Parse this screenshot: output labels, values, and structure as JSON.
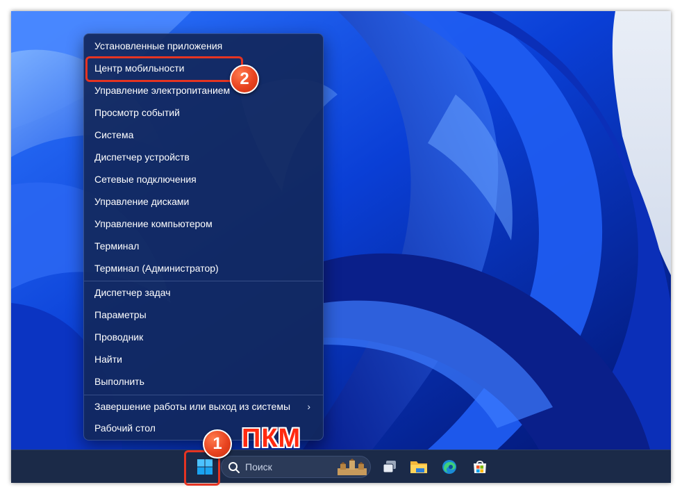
{
  "context_menu": {
    "items": [
      {
        "label": "Установленные приложения"
      },
      {
        "label": "Центр мобильности"
      },
      {
        "label": "Управление электропитанием"
      },
      {
        "label": "Просмотр событий"
      },
      {
        "label": "Система"
      },
      {
        "label": "Диспетчер устройств"
      },
      {
        "label": "Сетевые подключения"
      },
      {
        "label": "Управление дисками"
      },
      {
        "label": "Управление компьютером"
      },
      {
        "label": "Терминал"
      },
      {
        "label": "Терминал (Администратор)"
      },
      {
        "label": "Диспетчер задач"
      },
      {
        "label": "Параметры"
      },
      {
        "label": "Проводник"
      },
      {
        "label": "Найти"
      },
      {
        "label": "Выполнить"
      },
      {
        "label": "Завершение работы или выход из системы",
        "submenu_icon": "chevron-right-icon"
      },
      {
        "label": "Рабочий стол"
      }
    ]
  },
  "annotations": {
    "step1": "1",
    "step2": "2",
    "right_click_label": "ПКМ",
    "accent_color": "#e53422"
  },
  "taskbar": {
    "search_placeholder": "Поиск",
    "icons": [
      "start-icon",
      "search-icon",
      "task-view-icon",
      "file-explorer-icon",
      "edge-icon",
      "store-icon"
    ]
  },
  "colors": {
    "menu_background": "#12285c",
    "taskbar_background": "#1b2a48",
    "wallpaper_base": "#0a3fd6"
  }
}
